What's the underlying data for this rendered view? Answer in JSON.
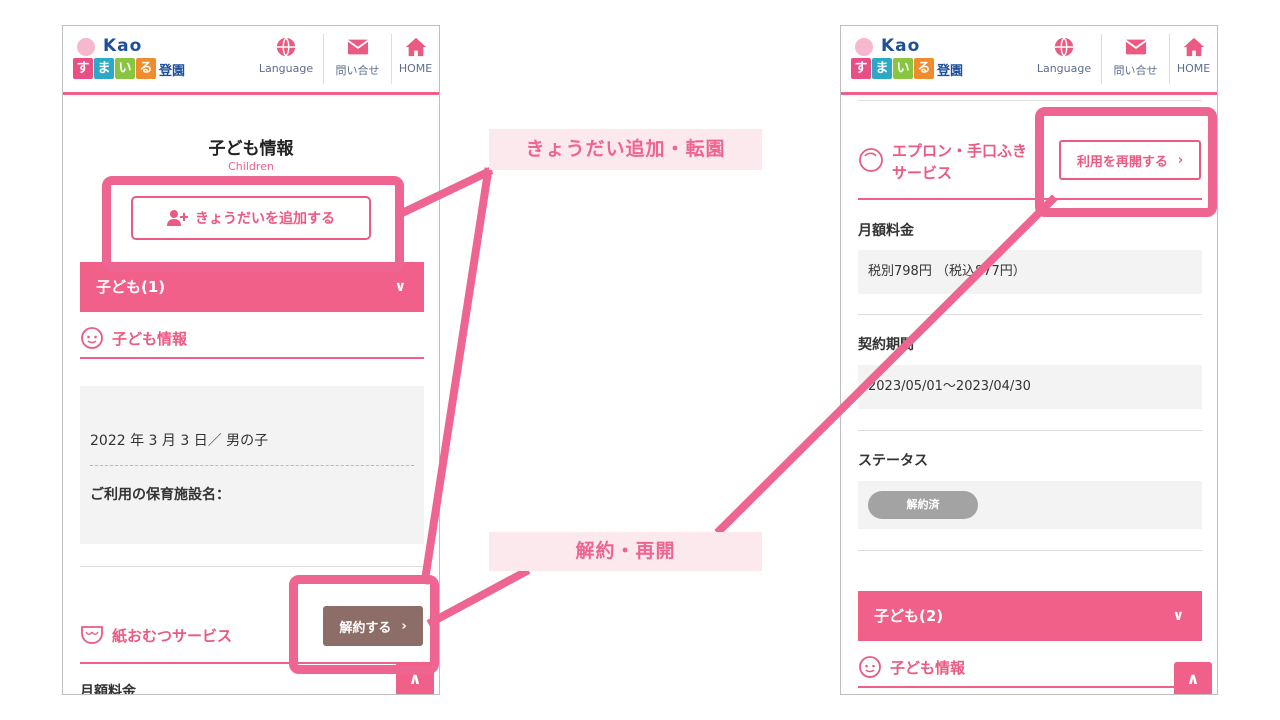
{
  "brand": {
    "name": "Kao",
    "blocks": [
      "す",
      "ま",
      "い",
      "る"
    ],
    "tail": "登園",
    "colors": [
      "#e94f84",
      "#2ca9c7",
      "#8ac541",
      "#f08c2d"
    ]
  },
  "nav": [
    {
      "label": "Language",
      "icon": "globe-icon"
    },
    {
      "label": "問い合せ",
      "icon": "mail-icon"
    },
    {
      "label": "HOME",
      "icon": "home-icon"
    }
  ],
  "left": {
    "title": "子ども情報",
    "subtitle": "Children",
    "add_sibling_button": "きょうだいを追加する",
    "child_bar": "子ども(1)",
    "child_info_heading": "子ども情報",
    "birth_gender": "2022 年 3 月 3 日／ 男の子",
    "facility_label": "ご利用の保育施設名：",
    "diaper_service": "紙おむつサービス",
    "cancel_button": "解約する",
    "monthly_fee_label": "月額料金"
  },
  "right": {
    "service_name_line1": "エプロン・手口ふき",
    "service_name_line2": "サービス",
    "resume_button": "利用を再開する",
    "monthly_fee_label": "月額料金",
    "monthly_fee_value": "税別798円 （税込877円）",
    "contract_period_label": "契約期間",
    "contract_period_value": "2023/05/01～2023/04/30",
    "status_label": "ステータス",
    "status_value": "解約済",
    "child_bar": "子ども(2)",
    "child_info_heading": "子ども情報"
  },
  "callouts": {
    "top": "きょうだい追加・転園",
    "bottom": "解約・再開"
  },
  "accent_color": "#ef6591"
}
